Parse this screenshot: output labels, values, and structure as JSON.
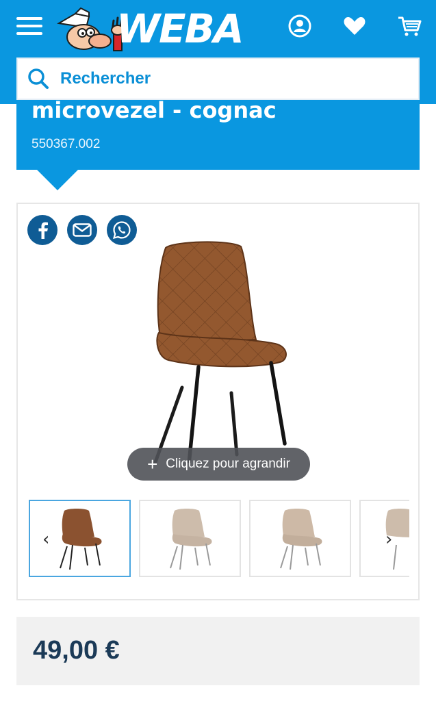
{
  "header": {
    "logo_text": "WEBA",
    "icons": [
      "menu-icon",
      "user-icon",
      "heart-icon",
      "cart-icon"
    ],
    "brand_color": "#0a97e0"
  },
  "search": {
    "placeholder": "Rechercher"
  },
  "product": {
    "title": "microvezel - cognac",
    "sku": "550367.002",
    "price": "49,00 €"
  },
  "gallery": {
    "share_icons": [
      "facebook-icon",
      "email-icon",
      "whatsapp-icon"
    ],
    "zoom_label": "Cliquez pour agrandir",
    "thumbnails": [
      {
        "color": "#8b5230",
        "active": true
      },
      {
        "color": "#cdbcab",
        "active": false
      },
      {
        "color": "#cdbcab",
        "active": false
      },
      {
        "color": "#cdbcab",
        "active": false
      }
    ]
  }
}
